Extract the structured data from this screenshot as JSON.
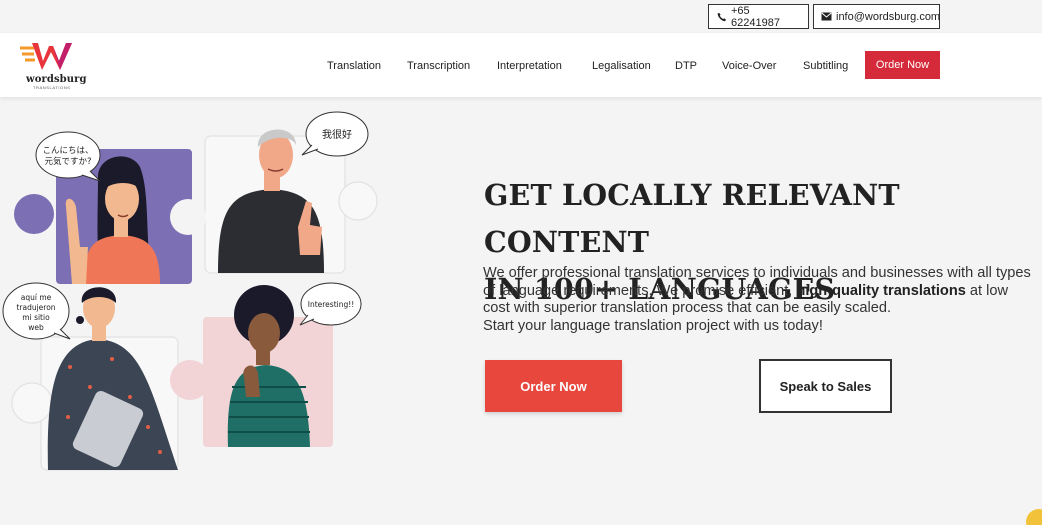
{
  "topbar": {
    "phone": "+65 62241987",
    "email": "info@wordsburg.com"
  },
  "logo": {
    "name": "wordsburg",
    "sub": "TRANSLATIONS"
  },
  "nav": {
    "items": [
      "Translation",
      "Transcription",
      "Interpretation",
      "Legalisation",
      "DTP",
      "Voice-Over",
      "Subtitling"
    ],
    "order": "Order Now"
  },
  "hero": {
    "headline_line1": "GET LOCALLY RELEVANT CONTENT",
    "headline_line2": "IN 100+ LANGUAGES",
    "desc_part1": "We offer professional translation services to individuals and businesses with all types of language requirements. We promise efficient, ",
    "desc_bold": "high-quality translations",
    "desc_part2": " at low cost with superior translation process that can be easily scaled.",
    "desc_line2": "Start your language translation project with us today!",
    "btn_order": "Order Now",
    "btn_sales": "Speak to Sales"
  },
  "bubbles": {
    "japanese_line1": "こんにちは、",
    "japanese_line2": "元気ですか?",
    "chinese": "我很好",
    "spanish_line1": "aquí me",
    "spanish_line2": "tradujeron",
    "spanish_line3": "mi sitio",
    "spanish_line4": "web",
    "english": "Interesting!!"
  },
  "colors": {
    "order_nav": "#d42a3a",
    "order_btn": "#e8473e",
    "purple_tile": "#7c6fb4",
    "pink_tile": "#f2d3d6"
  }
}
